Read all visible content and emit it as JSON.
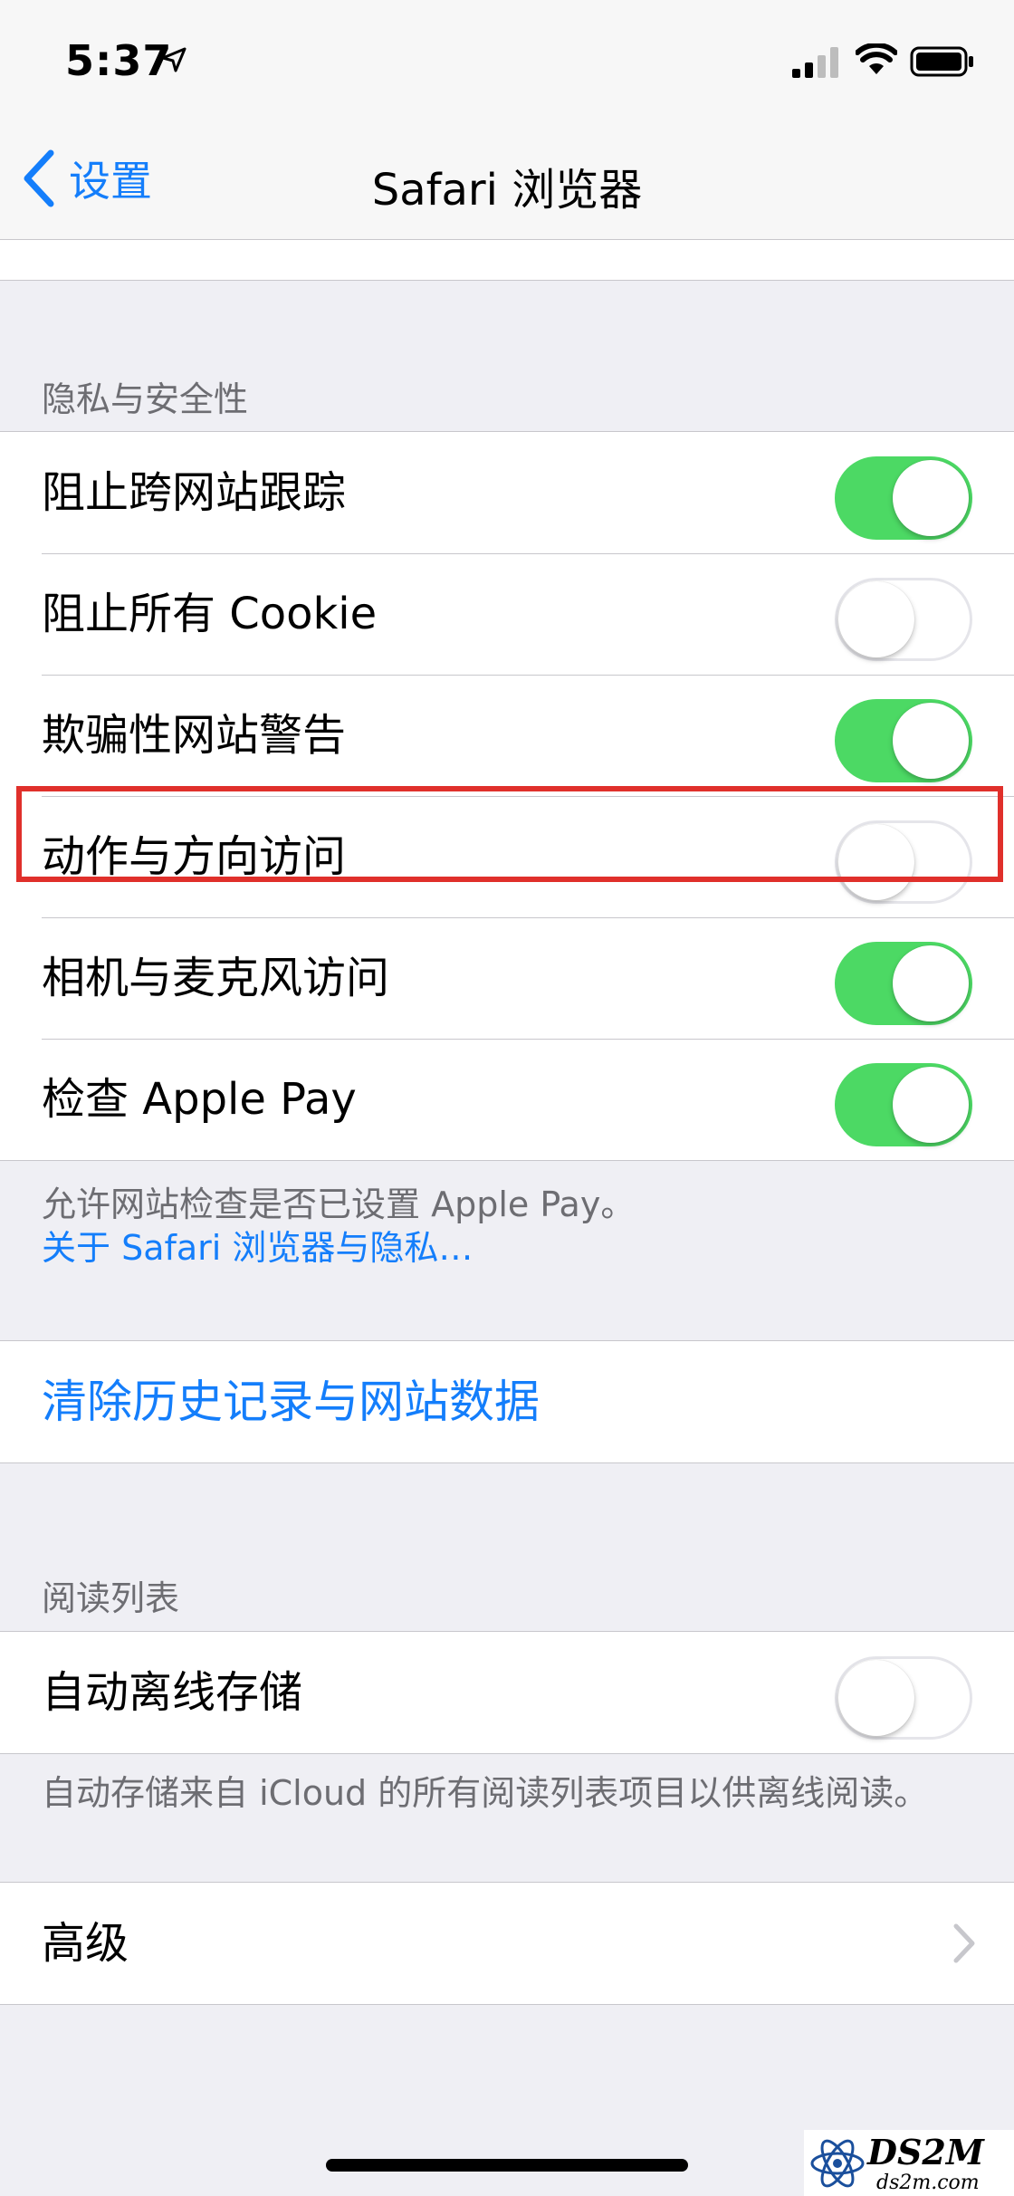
{
  "status": {
    "time": "5:37"
  },
  "nav": {
    "back_label": "设置",
    "title": "Safari 浏览器"
  },
  "privacy": {
    "header": "隐私与安全性",
    "rows": [
      {
        "label": "阻止跨网站跟踪",
        "on": true
      },
      {
        "label": "阻止所有 Cookie",
        "on": false
      },
      {
        "label": "欺骗性网站警告",
        "on": true
      },
      {
        "label": "动作与方向访问",
        "on": false
      },
      {
        "label": "相机与麦克风访问",
        "on": true
      },
      {
        "label": "检查 Apple Pay",
        "on": true
      }
    ],
    "footer_text": "允许网站检查是否已设置 Apple Pay。",
    "footer_link": "关于 Safari 浏览器与隐私…"
  },
  "clear_history": {
    "label": "清除历史记录与网站数据"
  },
  "reading_list": {
    "header": "阅读列表",
    "row": {
      "label": "自动离线存储",
      "on": false
    },
    "footer_text": "自动存储来自 iCloud 的所有阅读列表项目以供离线阅读。"
  },
  "advanced": {
    "label": "高级"
  },
  "watermark": {
    "text": "DS2M",
    "sub": "ds2m.com"
  },
  "colors": {
    "accent": "#147efb",
    "toggle_on": "#4cd964",
    "highlight": "#e0302b"
  }
}
